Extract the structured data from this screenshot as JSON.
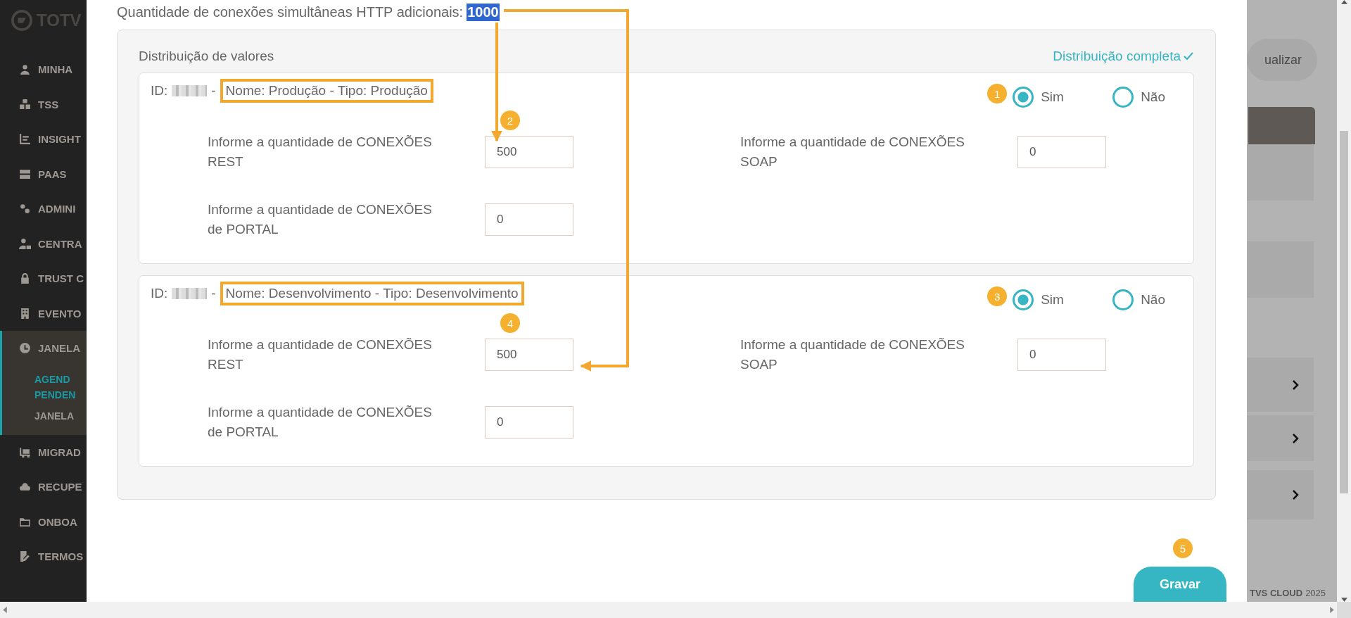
{
  "sidebar": {
    "logo": "TOTV",
    "items": [
      {
        "label": "MINHA"
      },
      {
        "label": "TSS"
      },
      {
        "label": "INSIGHT"
      },
      {
        "label": "PAAS"
      },
      {
        "label": "ADMINI"
      },
      {
        "label": "CENTRA"
      },
      {
        "label": "TRUST C"
      },
      {
        "label": "EVENTO"
      },
      {
        "label": "JANELA",
        "selected": true,
        "expanded": true,
        "children": [
          {
            "label": "AGEND PENDEN",
            "selected": true
          },
          {
            "label": "JANELA",
            "selected": false
          }
        ]
      },
      {
        "label": "MIGRAD"
      },
      {
        "label": "RECUPE"
      },
      {
        "label": "ONBOA"
      },
      {
        "label": "TERMOS"
      }
    ]
  },
  "modal": {
    "http_label": "Quantidade de conexões simultâneas HTTP adicionais:",
    "http_value": "1000",
    "distribution": {
      "title": "Distribuição de valores",
      "status": "Distribuição completa",
      "environments": [
        {
          "id_label": "ID:",
          "separator": "-",
          "name": "Nome: Produção - Tipo: Produção",
          "badge": "1",
          "options": [
            {
              "label": "Sim",
              "selected": true
            },
            {
              "label": "Não",
              "selected": false
            }
          ],
          "fields": [
            {
              "label": "Informe a quantidade de CONEXÕES REST",
              "value": "500",
              "badge": "2"
            },
            {
              "label": "Informe a quantidade de CONEXÕES SOAP",
              "value": "0"
            },
            {
              "label": "Informe a quantidade de CONEXÕES de PORTAL",
              "value": "0"
            }
          ]
        },
        {
          "id_label": "ID:",
          "separator": "-",
          "name": "Nome: Desenvolvimento - Tipo: Desenvolvimento",
          "badge": "3",
          "options": [
            {
              "label": "Sim",
              "selected": true
            },
            {
              "label": "Não",
              "selected": false
            }
          ],
          "fields": [
            {
              "label": "Informe a quantidade de CONEXÕES REST",
              "value": "500",
              "badge": "4"
            },
            {
              "label": "Informe a quantidade de CONEXÕES SOAP",
              "value": "0"
            },
            {
              "label": "Informe a quantidade de CONEXÕES de PORTAL",
              "value": "0"
            }
          ]
        }
      ]
    },
    "save_button": "Gravar",
    "save_badge": "5"
  },
  "background": {
    "button": "ualizar",
    "footer_brand": "TVS CLOUD",
    "footer_year": "2025"
  }
}
